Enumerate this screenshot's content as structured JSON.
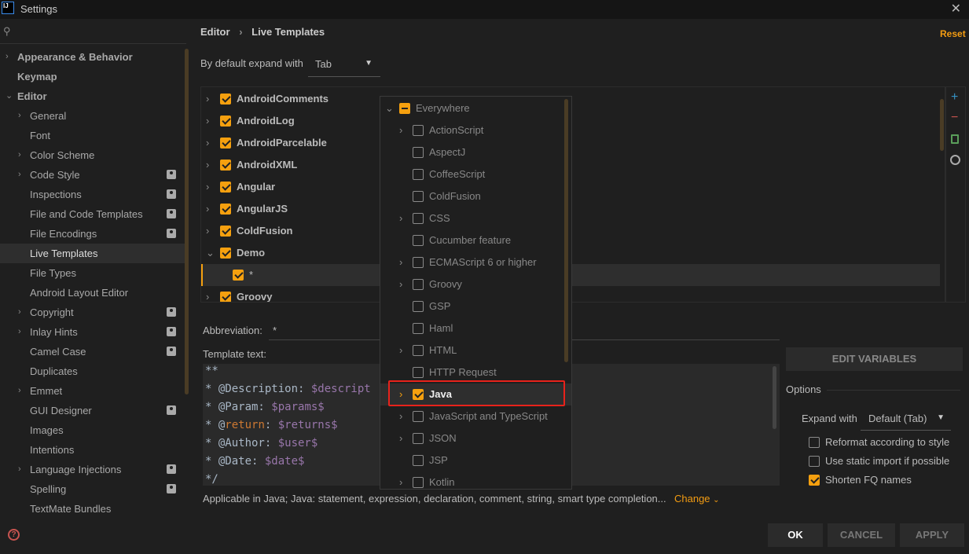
{
  "window": {
    "title": "Settings",
    "icon": "IJ",
    "close": "✕"
  },
  "sidebar": {
    "search_placeholder": "",
    "items": [
      {
        "label": "Appearance & Behavior",
        "level": 0,
        "chevron": "right",
        "bold": true
      },
      {
        "label": "Keymap",
        "level": 0,
        "bold": true
      },
      {
        "label": "Editor",
        "level": 0,
        "chevron": "down",
        "bold": true
      },
      {
        "label": "General",
        "level": 1,
        "chevron": "right"
      },
      {
        "label": "Font",
        "level": 1
      },
      {
        "label": "Color Scheme",
        "level": 1,
        "chevron": "right"
      },
      {
        "label": "Code Style",
        "level": 1,
        "chevron": "right",
        "profile": true
      },
      {
        "label": "Inspections",
        "level": 1,
        "profile": true
      },
      {
        "label": "File and Code Templates",
        "level": 1,
        "profile": true
      },
      {
        "label": "File Encodings",
        "level": 1,
        "profile": true
      },
      {
        "label": "Live Templates",
        "level": 1,
        "selected": true
      },
      {
        "label": "File Types",
        "level": 1
      },
      {
        "label": "Android Layout Editor",
        "level": 1
      },
      {
        "label": "Copyright",
        "level": 1,
        "chevron": "right",
        "profile": true
      },
      {
        "label": "Inlay Hints",
        "level": 1,
        "chevron": "right",
        "profile": true
      },
      {
        "label": "Camel Case",
        "level": 1,
        "profile": true
      },
      {
        "label": "Duplicates",
        "level": 1
      },
      {
        "label": "Emmet",
        "level": 1,
        "chevron": "right"
      },
      {
        "label": "GUI Designer",
        "level": 1,
        "profile": true
      },
      {
        "label": "Images",
        "level": 1
      },
      {
        "label": "Intentions",
        "level": 1
      },
      {
        "label": "Language Injections",
        "level": 1,
        "chevron": "right",
        "profile": true
      },
      {
        "label": "Spelling",
        "level": 1,
        "profile": true
      },
      {
        "label": "TextMate Bundles",
        "level": 1
      }
    ]
  },
  "breadcrumb": {
    "parent": "Editor",
    "separator": "›",
    "current": "Live Templates"
  },
  "reset_label": "Reset",
  "expand_default": {
    "label": "By default expand with",
    "value": "Tab"
  },
  "templates": [
    {
      "label": "AndroidComments",
      "chevron": "right",
      "checked": true,
      "bold": true
    },
    {
      "label": "AndroidLog",
      "chevron": "right",
      "checked": true,
      "bold": true
    },
    {
      "label": "AndroidParcelable",
      "chevron": "right",
      "checked": true,
      "bold": true
    },
    {
      "label": "AndroidXML",
      "chevron": "right",
      "checked": true,
      "bold": true
    },
    {
      "label": "Angular",
      "chevron": "right",
      "checked": true,
      "bold": true
    },
    {
      "label": "AngularJS",
      "chevron": "right",
      "checked": true,
      "bold": true
    },
    {
      "label": "ColdFusion",
      "chevron": "right",
      "checked": true,
      "bold": true
    },
    {
      "label": "Demo",
      "chevron": "down",
      "checked": true,
      "bold": true
    },
    {
      "label": "*",
      "checked": true,
      "child": true,
      "selected": true
    },
    {
      "label": "Groovy",
      "chevron": "right",
      "checked": true,
      "bold": true
    }
  ],
  "toolbar": {
    "add": "+",
    "remove": "−",
    "copy": "copy",
    "restore": "restore"
  },
  "contexts": [
    {
      "label": "Everywhere",
      "chevron": "down",
      "state": "mixed",
      "level": 0
    },
    {
      "label": "ActionScript",
      "chevron": "right",
      "state": "off",
      "level": 1
    },
    {
      "label": "AspectJ",
      "state": "off",
      "level": 1
    },
    {
      "label": "CoffeeScript",
      "state": "off",
      "level": 1
    },
    {
      "label": "ColdFusion",
      "state": "off",
      "level": 1
    },
    {
      "label": "CSS",
      "chevron": "right",
      "state": "off",
      "level": 1
    },
    {
      "label": "Cucumber feature",
      "state": "off",
      "level": 1
    },
    {
      "label": "ECMAScript 6 or higher",
      "chevron": "right",
      "state": "off",
      "level": 1
    },
    {
      "label": "Groovy",
      "chevron": "right",
      "state": "off",
      "level": 1
    },
    {
      "label": "GSP",
      "state": "off",
      "level": 1
    },
    {
      "label": "Haml",
      "state": "off",
      "level": 1
    },
    {
      "label": "HTML",
      "chevron": "right",
      "state": "off",
      "level": 1
    },
    {
      "label": "HTTP Request",
      "state": "off",
      "level": 1
    },
    {
      "label": "Java",
      "chevron": "right",
      "state": "on",
      "level": 1,
      "selected": true
    },
    {
      "label": "JavaScript and TypeScript",
      "chevron": "right",
      "state": "off",
      "level": 1
    },
    {
      "label": "JSON",
      "chevron": "right",
      "state": "off",
      "level": 1
    },
    {
      "label": "JSP",
      "state": "off",
      "level": 1
    },
    {
      "label": "Kotlin",
      "chevron": "right",
      "state": "off",
      "level": 1
    }
  ],
  "abbreviation": {
    "label": "Abbreviation:",
    "value": "*"
  },
  "template_text": {
    "label": "Template text:",
    "lines": [
      [
        [
          "t",
          "**"
        ]
      ],
      [
        [
          "t",
          "* @Description: "
        ],
        [
          "v",
          "$descript"
        ]
      ],
      [
        [
          "t",
          "* @Param: "
        ],
        [
          "v",
          "$params$"
        ]
      ],
      [
        [
          "t",
          "* @"
        ],
        [
          "k",
          "return"
        ],
        [
          "t",
          ": "
        ],
        [
          "v",
          "$returns$"
        ]
      ],
      [
        [
          "t",
          "* @Author: "
        ],
        [
          "v",
          "$user$"
        ]
      ],
      [
        [
          "t",
          "* @Date: "
        ],
        [
          "v",
          "$date$"
        ]
      ],
      [
        [
          "t",
          "*/"
        ]
      ]
    ]
  },
  "applicable": {
    "text": "Applicable in Java; Java: statement, expression, declaration, comment, string, smart type completion...",
    "change": "Change"
  },
  "edit_variables": "EDIT VARIABLES",
  "options": {
    "title": "Options",
    "expand_label": "Expand with",
    "expand_value": "Default (Tab)",
    "checks": [
      {
        "label": "Reformat according to style",
        "checked": false
      },
      {
        "label": "Use static import if possible",
        "checked": false
      },
      {
        "label": "Shorten FQ names",
        "checked": true
      }
    ]
  },
  "buttons": {
    "ok": "OK",
    "cancel": "CANCEL",
    "apply": "APPLY"
  },
  "colors": {
    "accent": "#f5a00f",
    "highlight": "#e8221b",
    "bg": "#1f1f1f"
  }
}
